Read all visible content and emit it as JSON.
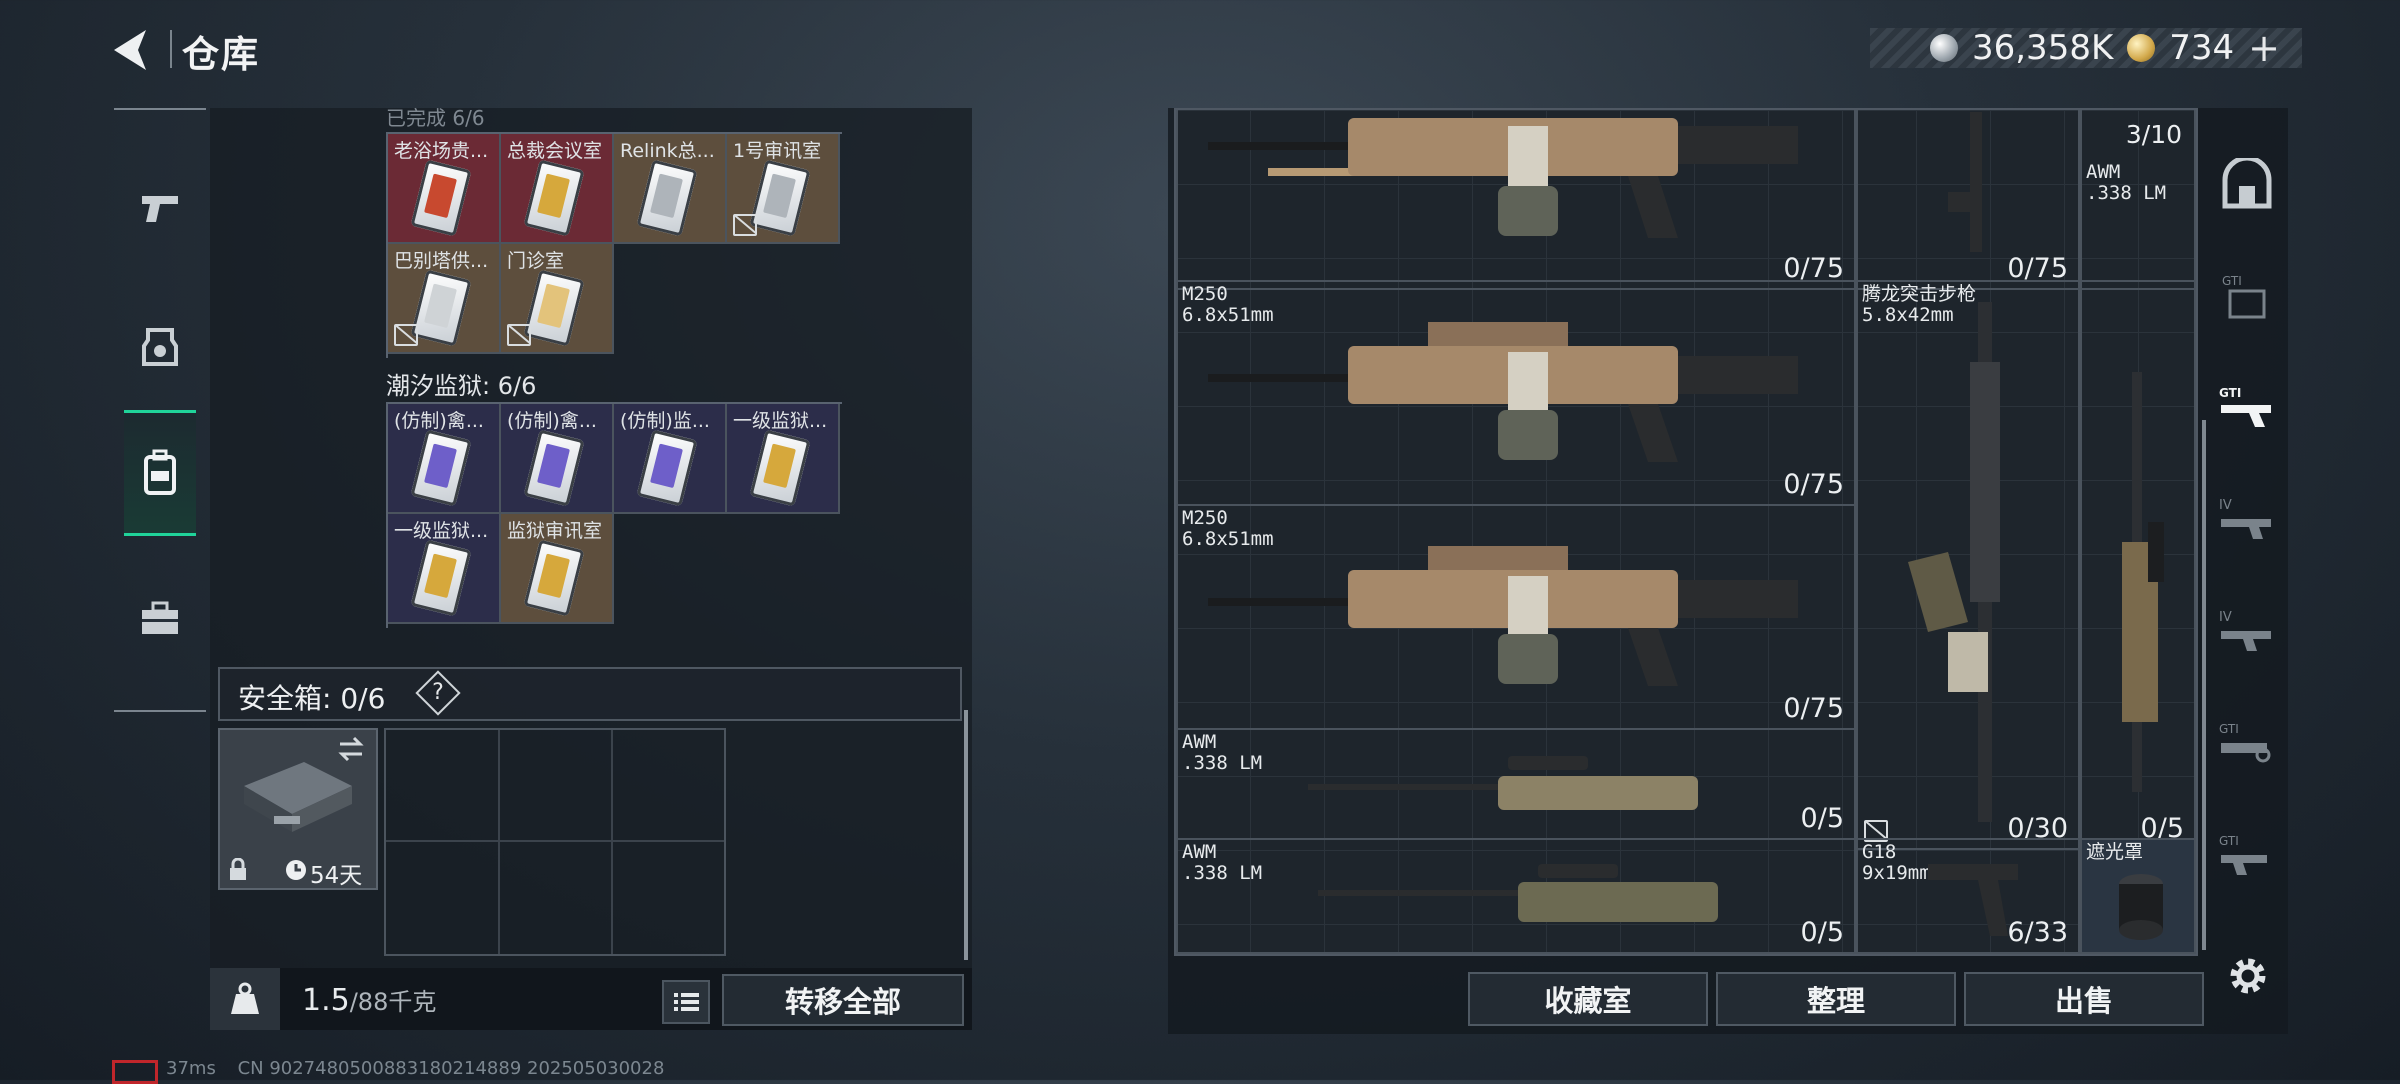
{
  "header": {
    "title": "仓库",
    "silver": "36,358K",
    "gold": "734",
    "plus": "+"
  },
  "left_rail": {
    "items": [
      "pistol-icon",
      "helmet-icon",
      "backpack-icon",
      "toolbox-icon"
    ]
  },
  "left_panel": {
    "cut_label": "已完成 6/6",
    "group1": [
      {
        "label": "老浴场贵...",
        "strip": "#c8492f",
        "bg": "#6b2a35"
      },
      {
        "label": "总裁会议室",
        "strip": "#d6a83c",
        "bg": "#6b2a35"
      },
      {
        "label": "Relink总...",
        "strip": "#aeb4ba",
        "bg": "#5d4e3d"
      },
      {
        "label": "1号审讯室",
        "strip": "#aeb4ba",
        "bg": "#5d4e3d"
      },
      {
        "label": "巴别塔供...",
        "strip": "#cfd3d6",
        "bg": "#5d4e3d"
      },
      {
        "label": "门诊室",
        "strip": "#e3c37b",
        "bg": "#5d4e3d"
      }
    ],
    "group2_title": "潮汐监狱: 6/6",
    "group2": [
      {
        "label": "(仿制)禽...",
        "strip": "#6e5fc9",
        "bg": "#2c2d4a"
      },
      {
        "label": "(仿制)禽...",
        "strip": "#6e5fc9",
        "bg": "#2c2d4a"
      },
      {
        "label": "(仿制)监...",
        "strip": "#6e5fc9",
        "bg": "#2c2d4a"
      },
      {
        "label": "一级监狱...",
        "strip": "#d6a83c",
        "bg": "#2c2d4a"
      },
      {
        "label": "一级监狱...",
        "strip": "#d6a83c",
        "bg": "#2c2d4a"
      },
      {
        "label": "监狱审讯室",
        "strip": "#d6a83c",
        "bg": "#5d4e3d"
      }
    ],
    "safe_label": "安全箱: 0/6",
    "safe_help": "?",
    "safebox_days": "54天",
    "weight": "1.5",
    "weight_max": "/88千克",
    "transfer_all": "转移全部"
  },
  "weapons": [
    {
      "name": "",
      "count": "0/75"
    },
    {
      "name": "",
      "count": "0/75"
    },
    {
      "name": "AWM\n.338 LM",
      "count": "3/10"
    },
    {
      "name": "M250\n6.8x51mm",
      "count": "0/75"
    },
    {
      "name": "腾龙突击步枪\n5.8x42mm",
      "count": "0/30"
    },
    {
      "name": "M250\n6.8x51mm",
      "count": "0/75"
    },
    {
      "name": "",
      "count": "0/5"
    },
    {
      "name": "AWM\n.338 LM",
      "count": "0/5"
    },
    {
      "name": "AWM\n.338 LM",
      "count": "0/5"
    },
    {
      "name": "G18\n9x19mm",
      "count": "6/33"
    },
    {
      "name": "遮光罩",
      "count": ""
    }
  ],
  "right_tabs": [
    "building-icon",
    "gti-b-icon",
    "gti-rifle-icon",
    "iv-icon-1",
    "iv-icon-2",
    "gti-c-icon",
    "gti-d-icon"
  ],
  "actions": {
    "collection": "收藏室",
    "organize": "整理",
    "sell": "出售"
  },
  "status": {
    "ping": "37ms",
    "session": "CN 9027480500883180214889 202505030028"
  },
  "colors": {
    "accent": "#20d49a",
    "rec": "#c0262b"
  }
}
